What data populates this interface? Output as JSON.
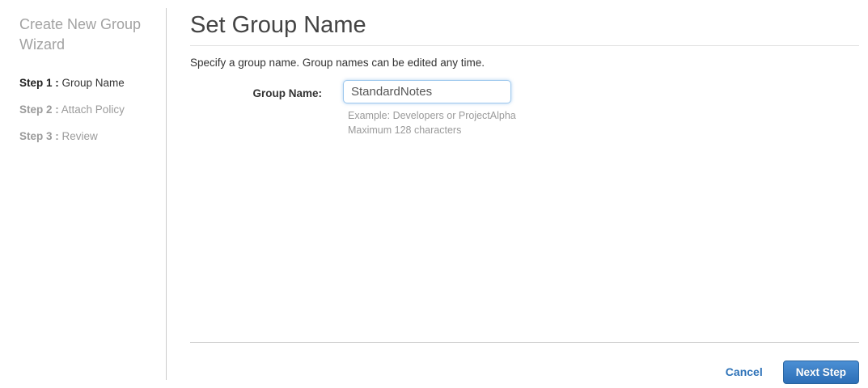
{
  "sidebar": {
    "title": "Create New Group Wizard",
    "steps": [
      {
        "prefix": "Step 1 :",
        "label": "Group Name"
      },
      {
        "prefix": "Step 2 :",
        "label": "Attach Policy"
      },
      {
        "prefix": "Step 3 :",
        "label": "Review"
      }
    ]
  },
  "main": {
    "title": "Set Group Name",
    "description": "Specify a group name. Group names can be edited any time.",
    "form": {
      "label": "Group Name:",
      "value": "StandardNotes",
      "hint_example": "Example: Developers or ProjectAlpha",
      "hint_max": "Maximum 128 characters"
    },
    "footer": {
      "cancel_label": "Cancel",
      "next_label": "Next Step"
    }
  },
  "colors": {
    "accent_blue": "#2d72b8",
    "button_gradient_top": "#4b8fd4",
    "button_gradient_bottom": "#2d6fb7",
    "input_focus_border": "#9ec8ee",
    "divider_gray": "#cccccc"
  }
}
